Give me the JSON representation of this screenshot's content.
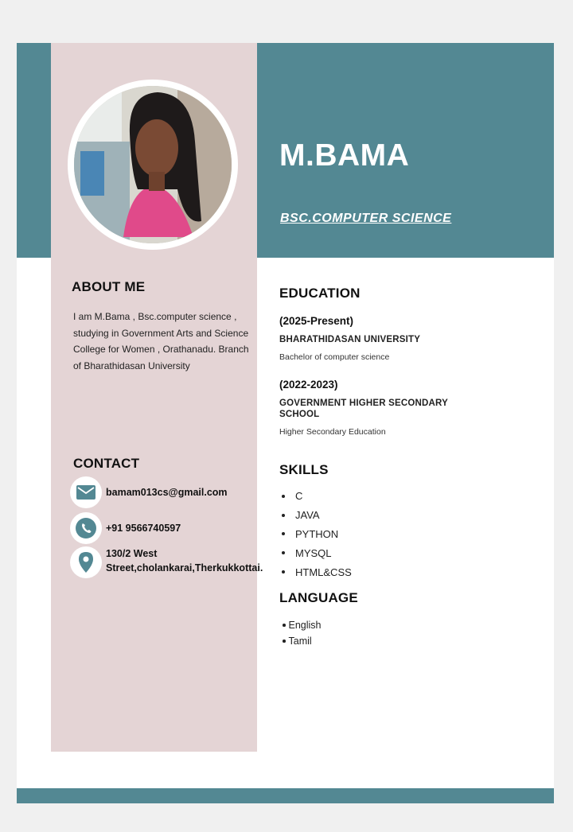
{
  "header": {
    "name": "M.BAMA",
    "degree": "BSC.COMPUTER SCIENCE"
  },
  "colors": {
    "teal": "#538893",
    "sidebar_pink": "#e4d4d5",
    "white": "#ffffff"
  },
  "about": {
    "title": "ABOUT ME",
    "text": "I am M.Bama , Bsc.computer science , studying in Government Arts and Science College for Women , Orathanadu. Branch of Bharathidasan University"
  },
  "contact": {
    "title": "CONTACT",
    "email": "bamam013cs@gmail.com",
    "phone": "+91 9566740597",
    "address": "130/2 West Street,cholankarai,Therkukkottai.",
    "icons": [
      "mail-icon",
      "phone-icon",
      "location-pin-icon"
    ]
  },
  "education": {
    "title": "EDUCATION",
    "items": [
      {
        "years": "(2025-Present)",
        "school": "BHARATHIDASAN UNIVERSITY",
        "desc": "Bachelor of computer science"
      },
      {
        "years": "(2022-2023)",
        "school": "GOVERNMENT HIGHER SECONDARY SCHOOL",
        "desc": "Higher Secondary Education"
      }
    ]
  },
  "skills": {
    "title": "SKILLS",
    "items": [
      "C",
      "JAVA",
      "PYTHON",
      "MYSQL",
      "HTML&CSS"
    ]
  },
  "language": {
    "title": "LANGUAGE",
    "items": [
      "English",
      "Tamil"
    ]
  }
}
